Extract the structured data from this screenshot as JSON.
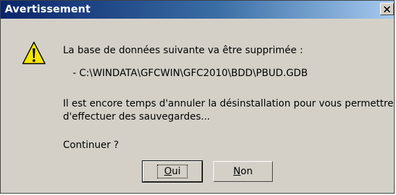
{
  "window": {
    "title": "Avertissement",
    "close_glyph": "×"
  },
  "icon": {
    "name": "warning-icon",
    "color": "#f5e400"
  },
  "message": {
    "line1": "La base de données suivante va être supprimée :",
    "path": "- C:\\WINDATA\\GFCWIN\\GFC2010\\BDD\\PBUD.GDB",
    "info_line1": "Il est encore temps d'annuler la désinstallation pour vous permettre",
    "info_line2": "d'effectuer des sauvegardes...",
    "question": "Continuer ?"
  },
  "buttons": {
    "yes": {
      "underlined": "O",
      "rest": "ui"
    },
    "no": {
      "underlined": "N",
      "rest": "on"
    }
  },
  "colors": {
    "dialog_bg": "#d4d0c8",
    "title_start": "#0a246a",
    "title_end": "#a6caf0",
    "title_text": "#ffffff"
  }
}
